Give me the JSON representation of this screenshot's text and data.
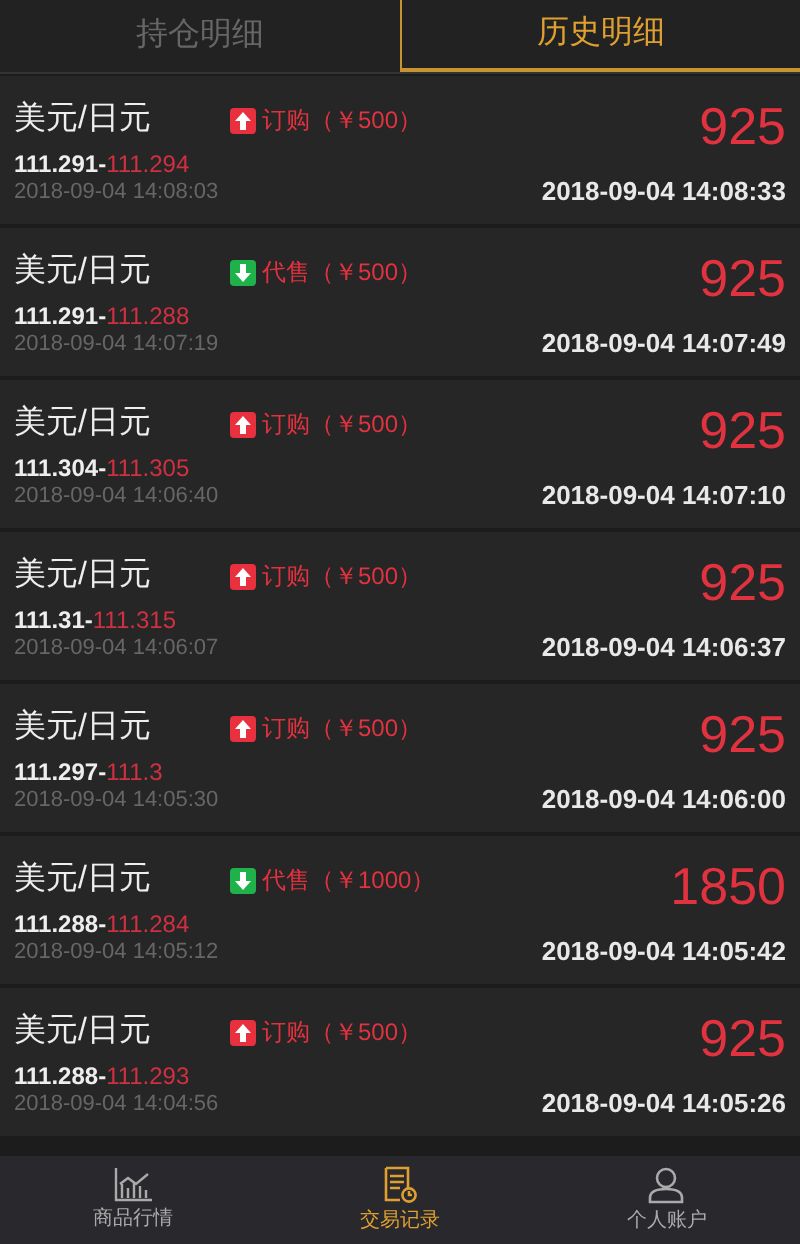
{
  "tabs": [
    {
      "label": "持仓明细",
      "selected": false
    },
    {
      "label": "历史明细",
      "selected": true
    }
  ],
  "records": [
    {
      "pair": "美元/日元",
      "kind": "buy",
      "order": "订购（￥500）",
      "open_price": "111.291",
      "separator": "-",
      "close_price": "111.294",
      "open_time": "2018-09-04 14:08:03",
      "amount": "925",
      "close_time": "2018-09-04 14:08:33"
    },
    {
      "pair": "美元/日元",
      "kind": "sell",
      "order": "代售（￥500）",
      "open_price": "111.291",
      "separator": "-",
      "close_price": "111.288",
      "open_time": "2018-09-04 14:07:19",
      "amount": "925",
      "close_time": "2018-09-04 14:07:49"
    },
    {
      "pair": "美元/日元",
      "kind": "buy",
      "order": "订购（￥500）",
      "open_price": "111.304",
      "separator": "-",
      "close_price": "111.305",
      "open_time": "2018-09-04 14:06:40",
      "amount": "925",
      "close_time": "2018-09-04 14:07:10"
    },
    {
      "pair": "美元/日元",
      "kind": "buy",
      "order": "订购（￥500）",
      "open_price": "111.31",
      "separator": "-",
      "close_price": "111.315",
      "open_time": "2018-09-04 14:06:07",
      "amount": "925",
      "close_time": "2018-09-04 14:06:37"
    },
    {
      "pair": "美元/日元",
      "kind": "buy",
      "order": "订购（￥500）",
      "open_price": "111.297",
      "separator": "-",
      "close_price": "111.3",
      "open_time": "2018-09-04 14:05:30",
      "amount": "925",
      "close_time": "2018-09-04 14:06:00"
    },
    {
      "pair": "美元/日元",
      "kind": "sell",
      "order": "代售（￥1000）",
      "open_price": "111.288",
      "separator": "-",
      "close_price": "111.284",
      "open_time": "2018-09-04 14:05:12",
      "amount": "1850",
      "close_time": "2018-09-04 14:05:42"
    },
    {
      "pair": "美元/日元",
      "kind": "buy",
      "order": "订购（￥500）",
      "open_price": "111.288",
      "separator": "-",
      "close_price": "111.293",
      "open_time": "2018-09-04 14:04:56",
      "amount": "925",
      "close_time": "2018-09-04 14:05:26"
    }
  ],
  "bottom_nav": [
    {
      "kind": "chart",
      "label": "商品行情",
      "selected": false
    },
    {
      "kind": "record",
      "label": "交易记录",
      "selected": true
    },
    {
      "kind": "user",
      "label": "个人账户",
      "selected": false
    }
  ]
}
